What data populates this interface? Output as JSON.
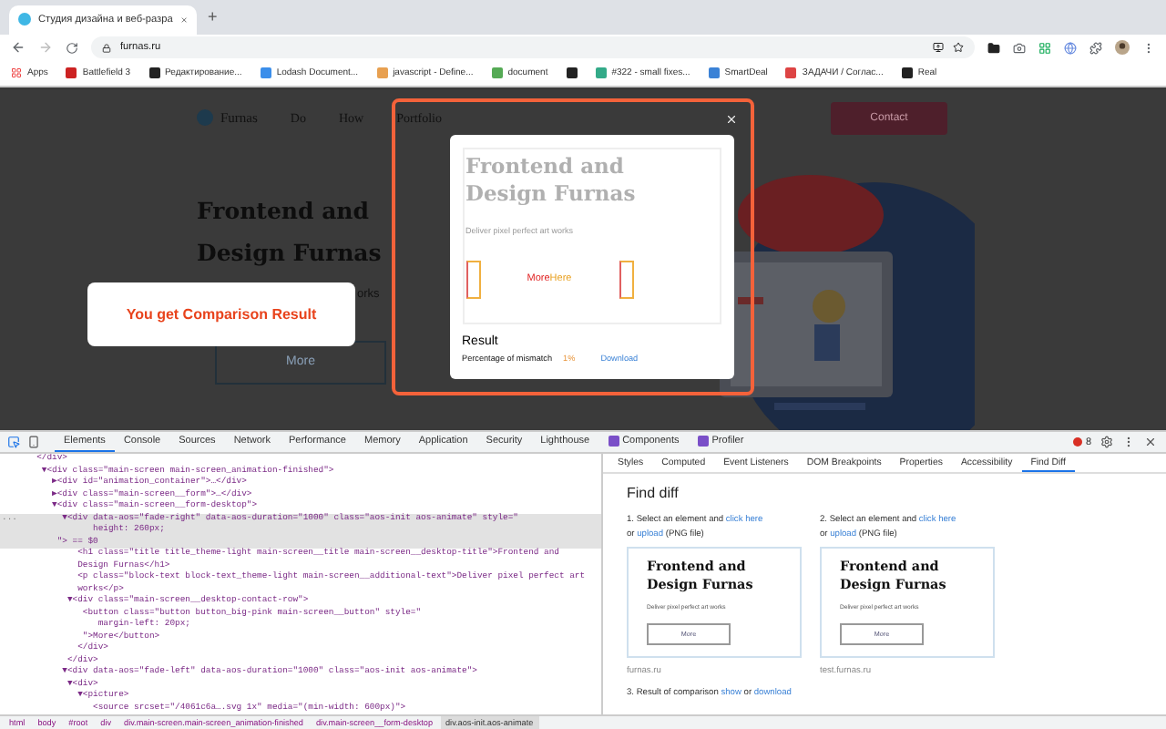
{
  "browser": {
    "tab_title": "Студия дизайна и веб-разра",
    "new_tab": "+",
    "address": "furnas.ru",
    "bookmarks": [
      {
        "kind": "apps",
        "label": "Apps"
      },
      {
        "kind": "site",
        "label": "Battlefield 3"
      },
      {
        "kind": "site",
        "label": "Редактирование..."
      },
      {
        "kind": "site",
        "label": "Lodash Document..."
      },
      {
        "kind": "site",
        "label": "javascript - Define..."
      },
      {
        "kind": "site",
        "label": "document"
      },
      {
        "kind": "icon"
      },
      {
        "kind": "site",
        "label": "#322 - small fixes..."
      },
      {
        "kind": "site",
        "label": "SmartDeal"
      },
      {
        "kind": "site",
        "label": "ЗАДАЧИ / Соглас..."
      },
      {
        "kind": "site",
        "label": "Real"
      }
    ]
  },
  "page": {
    "logo": "Furnas",
    "nav": [
      "Do",
      "How",
      "Portfolio"
    ],
    "contact": "Contact",
    "hero_title": [
      "Frontend and",
      "Design Furnas"
    ],
    "hero_text": "orks",
    "more": "More"
  },
  "callout": "You get Comparison Result",
  "result_popup": {
    "preview_title": [
      "Frontend and",
      "Design Furnas"
    ],
    "preview_text": "Deliver pixel perfect art works",
    "diff_texts": [
      "More",
      "Here"
    ],
    "result_title": "Result",
    "mismatch_label": "Percentage of mismatch",
    "mismatch_value": "1%",
    "download": "Download"
  },
  "devtools": {
    "tabs": [
      {
        "label": "Elements",
        "selected": true,
        "kind": "plain"
      },
      {
        "label": "Console",
        "selected": false,
        "kind": "plain"
      },
      {
        "label": "Sources",
        "selected": false,
        "kind": "plain"
      },
      {
        "label": "Network",
        "selected": false,
        "kind": "plain"
      },
      {
        "label": "Performance",
        "selected": false,
        "kind": "plain"
      },
      {
        "label": "Memory",
        "selected": false,
        "kind": "plain"
      },
      {
        "label": "Application",
        "selected": false,
        "kind": "plain"
      },
      {
        "label": "Security",
        "selected": false,
        "kind": "plain"
      },
      {
        "label": "Lighthouse",
        "selected": false,
        "kind": "plain"
      },
      {
        "label": "Components",
        "selected": false,
        "kind": "extension"
      },
      {
        "label": "Profiler",
        "selected": false,
        "kind": "extension"
      }
    ],
    "error_count": "8",
    "code_lines": [
      {
        "text": "     </div>",
        "selected": false
      },
      {
        "text": "      ▼<div class=\"main-screen main-screen_animation-finished\">",
        "selected": false
      },
      {
        "text": "        ▶<div id=\"animation_container\">…</div>",
        "selected": false
      },
      {
        "text": "        ▶<div class=\"main-screen__form\">…</div>",
        "selected": false
      },
      {
        "text": "        ▼<div class=\"main-screen__form-desktop\">",
        "selected": false
      },
      {
        "text": "          ▼<div data-aos=\"fade-right\" data-aos-duration=\"1000\" class=\"aos-init aos-animate\" style=\"",
        "selected": true,
        "gutter": "..."
      },
      {
        "text": "                height: 260px;",
        "selected": true
      },
      {
        "text": "         \"> == $0",
        "selected": true
      },
      {
        "text": "             <h1 class=\"title title_theme-light main-screen__title main-screen__desktop-title\">Frontend and",
        "selected": false
      },
      {
        "text": "             Design Furnas</h1>",
        "selected": false
      },
      {
        "text": "             <p class=\"block-text block-text_theme-light main-screen__additional-text\">Deliver pixel perfect art",
        "selected": false
      },
      {
        "text": "             works</p>",
        "selected": false
      },
      {
        "text": "           ▼<div class=\"main-screen__desktop-contact-row\">",
        "selected": false
      },
      {
        "text": "              <button class=\"button button_big-pink main-screen__button\" style=\"",
        "selected": false
      },
      {
        "text": "                 margin-left: 20px;",
        "selected": false
      },
      {
        "text": "              \">More</button>",
        "selected": false
      },
      {
        "text": "             </div>",
        "selected": false
      },
      {
        "text": "           </div>",
        "selected": false
      },
      {
        "text": "          ▼<div data-aos=\"fade-left\" data-aos-duration=\"1000\" class=\"aos-init aos-animate\">",
        "selected": false
      },
      {
        "text": "           ▼<div>",
        "selected": false
      },
      {
        "text": "             ▼<picture>",
        "selected": false
      },
      {
        "text": "                <source srcset=\"/4061c6a….svg 1x\" media=\"(min-width: 600px)\">",
        "selected": false
      }
    ],
    "side_tabs": [
      {
        "label": "Styles",
        "selected": false
      },
      {
        "label": "Computed",
        "selected": false
      },
      {
        "label": "Event Listeners",
        "selected": false
      },
      {
        "label": "DOM Breakpoints",
        "selected": false
      },
      {
        "label": "Properties",
        "selected": false
      },
      {
        "label": "Accessibility",
        "selected": false
      },
      {
        "label": "Find Diff",
        "selected": true
      }
    ],
    "find_diff": {
      "title": "Find diff",
      "steps": [
        {
          "line1": {
            "before": "1. Select an element and ",
            "link": "click here"
          },
          "line2": {
            "before": "or ",
            "link": "upload",
            "after": " (PNG file)"
          },
          "card": {
            "title": [
              "Frontend and",
              "Design Furnas"
            ],
            "text": "Deliver pixel perfect art works",
            "button": "More"
          },
          "caption": "furnas.ru"
        },
        {
          "line1": {
            "before": "2. Select an element and ",
            "link": "click here"
          },
          "line2": {
            "before": "or ",
            "link": "upload",
            "after": " (PNG file)"
          },
          "card": {
            "title": [
              "Frontend and",
              "Design Furnas"
            ],
            "text": "Deliver pixel perfect art works",
            "button": "More"
          },
          "caption": "test.furnas.ru"
        }
      ],
      "result": {
        "before": "3. Result of comparison ",
        "link1": "show",
        "middle": " or ",
        "link2": "download"
      }
    },
    "breadcrumbs": [
      {
        "label": "html",
        "selected": false
      },
      {
        "label": "body",
        "selected": false
      },
      {
        "label": "#root",
        "selected": false
      },
      {
        "label": "div",
        "selected": false
      },
      {
        "label": "div.main-screen.main-screen_animation-finished",
        "selected": false
      },
      {
        "label": "div.main-screen__form-desktop",
        "selected": false
      },
      {
        "label": "div.aos-init.aos-animate",
        "selected": true
      }
    ]
  }
}
